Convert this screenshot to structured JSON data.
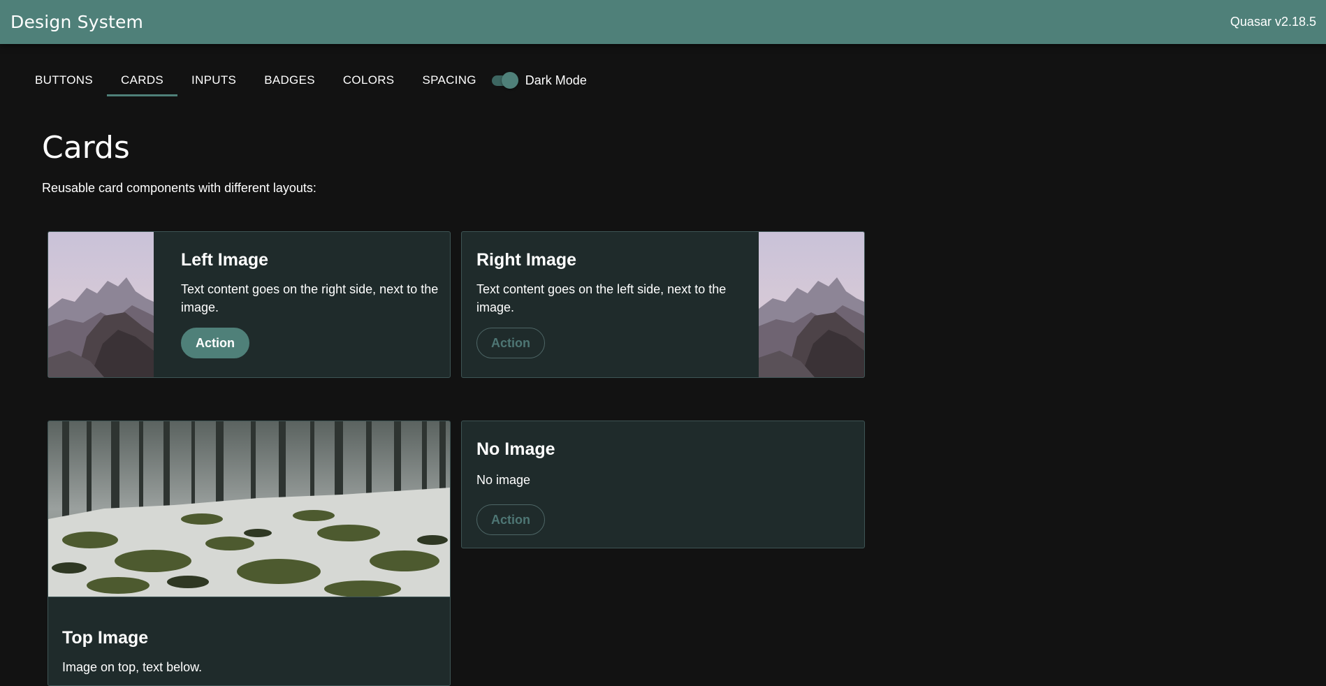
{
  "header": {
    "title": "Design System",
    "version": "Quasar v2.18.5"
  },
  "tabs": [
    {
      "label": "BUTTONS",
      "active": false
    },
    {
      "label": "CARDS",
      "active": true
    },
    {
      "label": "INPUTS",
      "active": false
    },
    {
      "label": "BADGES",
      "active": false
    },
    {
      "label": "COLORS",
      "active": false
    },
    {
      "label": "SPACING",
      "active": false
    }
  ],
  "dark_mode": {
    "label": "Dark Mode",
    "enabled": true
  },
  "page": {
    "title": "Cards",
    "subtitle": "Reusable card components with different layouts:"
  },
  "cards": {
    "left_image": {
      "title": "Left Image",
      "text": "Text content goes on the right side, next to the image.",
      "action": "Action",
      "image_icon": "mountain-photo"
    },
    "right_image": {
      "title": "Right Image",
      "text": "Text content goes on the left side, next to the image.",
      "action": "Action",
      "image_icon": "mountain-photo"
    },
    "top_image": {
      "title": "Top Image",
      "text": "Image on top, text below.",
      "image_icon": "forest-snow-photo"
    },
    "no_image": {
      "title": "No Image",
      "text": "No image",
      "action": "Action"
    }
  },
  "colors": {
    "primary": "#4f8079",
    "background": "#121212",
    "card_background": "#1f2b2b",
    "card_border": "#3e5555"
  }
}
